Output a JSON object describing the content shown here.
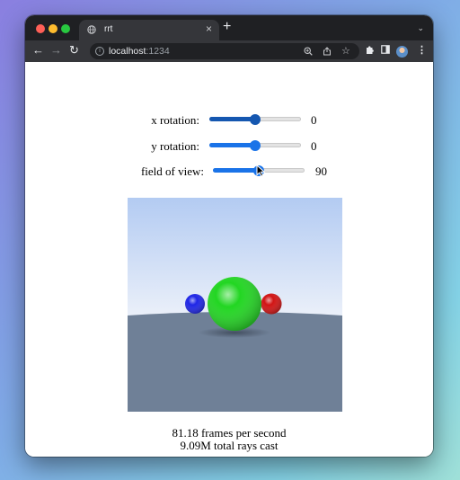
{
  "browser": {
    "tab_title": "rrt",
    "tab_close_glyph": "×",
    "new_tab_glyph": "+",
    "tab_menu_glyph": "⌄",
    "url_host": "localhost",
    "url_port": ":1234",
    "icons": {
      "back": "back-arrow-icon",
      "forward": "forward-arrow-icon",
      "reload": "reload-icon",
      "site_info": "info-icon",
      "zoom": "zoom-icon",
      "share": "share-icon",
      "bookmark": "star-icon",
      "extensions": "puzzle-icon",
      "sidepanel": "sidepanel-icon",
      "profile": "avatar",
      "menu": "kebab-menu-icon"
    }
  },
  "controls": {
    "x_rotation": {
      "label": "x rotation:",
      "value": "0",
      "fraction": 0.5
    },
    "y_rotation": {
      "label": "y rotation:",
      "value": "0",
      "fraction": 0.5
    },
    "fov": {
      "label": "field of view:",
      "value": "90",
      "fraction": 0.5
    }
  },
  "scene": {
    "sky_top": "#b3cbf2",
    "sky_bottom": "#eef2fa",
    "ground": "#6f8097",
    "spheres": [
      {
        "name": "blue",
        "color": "#1e25e6"
      },
      {
        "name": "green",
        "color": "#22d622"
      },
      {
        "name": "red",
        "color": "#d11414"
      }
    ]
  },
  "stats": {
    "fps": "81.18 frames per second",
    "rays": "9.09M total rays cast"
  },
  "colors": {
    "accent": "#1a73e8",
    "accent_pressed": "#1557b0"
  }
}
